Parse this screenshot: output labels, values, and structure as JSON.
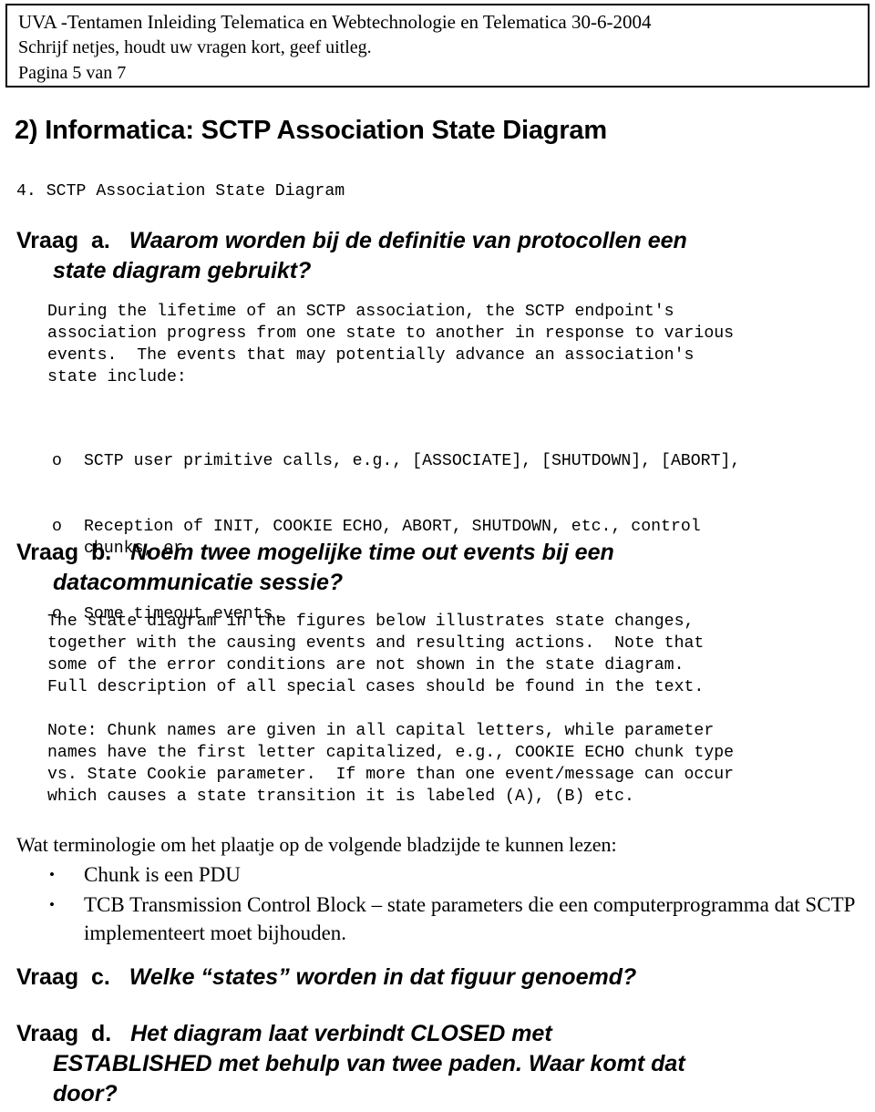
{
  "header": {
    "line1": "UVA -Tentamen Inleiding Telematica en Webtechnologie en Telematica 30-6-2004",
    "line2": "Schrijf netjes, houdt uw vragen kort, geef uitleg.",
    "line3": "Pagina 5 van 7"
  },
  "section": {
    "title": "2) Informatica: SCTP Association State Diagram",
    "caption": "4. SCTP Association State Diagram"
  },
  "vraag_a": {
    "lead": "Vraag  a.   ",
    "question_line1": "Waarom worden bij de definitie van protocollen een",
    "question_line2": "state diagram gebruikt?"
  },
  "para_a": "During the lifetime of an SCTP association, the SCTP endpoint's\nassociation progress from one state to another in response to various\nevents.  The events that may potentially advance an association's\nstate include:",
  "list_a": {
    "marker": "o",
    "items": [
      "SCTP user primitive calls, e.g., [ASSOCIATE], [SHUTDOWN], [ABORT],",
      "Reception of INIT, COOKIE ECHO, ABORT, SHUTDOWN, etc., control\nchunks, or",
      "Some timeout events."
    ]
  },
  "vraag_b": {
    "lead": "Vraag  b.   ",
    "question_line1": "Noem twee mogelijke time out events bij een",
    "question_line2": "datacommunicatie sessie?"
  },
  "para_b": "The state diagram in the figures below illustrates state changes,\ntogether with the causing events and resulting actions.  Note that\nsome of the error conditions are not shown in the state diagram.\nFull description of all special cases should be found in the text.",
  "para_note": "Note: Chunk names are given in all capital letters, while parameter\nnames have the first letter capitalized, e.g., COOKIE ECHO chunk type\nvs. State Cookie parameter.  If more than one event/message can occur\nwhich causes a state transition it is labeled (A), (B) etc.",
  "terminology": {
    "intro": "Wat terminologie om het plaatje op de volgende bladzijde te kunnen lezen:",
    "bullet_glyph": "•",
    "items": [
      "Chunk is een PDU",
      "TCB Transmission Control Block – state parameters die een computerprogramma dat SCTP implementeert moet bijhouden."
    ]
  },
  "vraag_c": {
    "lead": "Vraag  c.   ",
    "question_line1": "Welke “states” worden in dat figuur genoemd?"
  },
  "vraag_d": {
    "lead": "Vraag  d.   ",
    "question_line1": "Het diagram laat verbindt CLOSED met",
    "question_line2": "ESTABLISHED met behulp van twee paden. Waar komt dat",
    "question_line3": "door?"
  },
  "colors": {
    "text": "#000000",
    "background": "#ffffff",
    "border": "#000000"
  }
}
